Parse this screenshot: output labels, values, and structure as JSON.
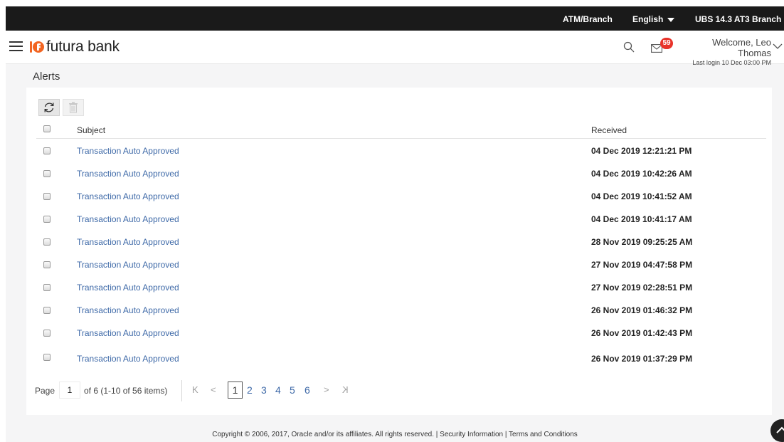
{
  "topbar": {
    "atm_label": "ATM/Branch",
    "language_label": "English",
    "branch_label": "UBS 14.3 AT3 Branch"
  },
  "header": {
    "brand_name": "futura bank",
    "mail_count": "59",
    "welcome_text": "Welcome, Leo Thomas",
    "last_login": "Last login 10 Dec 03:00 PM"
  },
  "page": {
    "title": "Alerts"
  },
  "table": {
    "columns": {
      "subject": "Subject",
      "received": "Received"
    },
    "rows": [
      {
        "subject": "Transaction Auto Approved",
        "received": "04 Dec 2019 12:21:21 PM"
      },
      {
        "subject": "Transaction Auto Approved",
        "received": "04 Dec 2019 10:42:26 AM"
      },
      {
        "subject": "Transaction Auto Approved",
        "received": "04 Dec 2019 10:41:52 AM"
      },
      {
        "subject": "Transaction Auto Approved",
        "received": "04 Dec 2019 10:41:17 AM"
      },
      {
        "subject": "Transaction Auto Approved",
        "received": "28 Nov 2019 09:25:25 AM"
      },
      {
        "subject": "Transaction Auto Approved",
        "received": "27 Nov 2019 04:47:58 PM"
      },
      {
        "subject": "Transaction Auto Approved",
        "received": "27 Nov 2019 02:28:51 PM"
      },
      {
        "subject": "Transaction Auto Approved",
        "received": "26 Nov 2019 01:46:32 PM"
      },
      {
        "subject": "Transaction Auto Approved",
        "received": "26 Nov 2019 01:42:43 PM"
      },
      {
        "subject": "Transaction Auto Approved",
        "received": "26 Nov 2019 01:37:29 PM"
      }
    ]
  },
  "pagination": {
    "page_label": "Page",
    "current_page": "1",
    "summary": "of 6  (1-10 of 56 items)",
    "first_symbol": "K",
    "prev_symbol": "<",
    "next_symbol": ">",
    "last_symbol": "K",
    "pages": [
      "1",
      "2",
      "3",
      "4",
      "5",
      "6"
    ]
  },
  "footer": {
    "text": "Copyright © 2006, 2017, Oracle and/or its affiliates. All rights reserved. | Security Information | Terms and Conditions"
  },
  "colors": {
    "topbar_bg": "#1a1a1a",
    "link": "#3f6aa8",
    "badge": "#e8332a",
    "brand_orange": "#f26522",
    "page_bg": "#f5f5f6"
  },
  "icons": [
    "hamburger-icon",
    "brand-logo-icon",
    "search-icon",
    "mail-icon",
    "chevron-down-icon",
    "refresh-icon",
    "delete-icon",
    "scroll-top-icon"
  ]
}
